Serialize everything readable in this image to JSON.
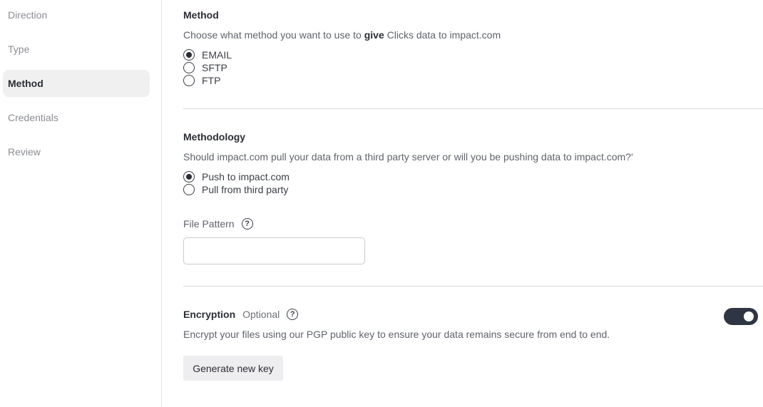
{
  "sidebar": {
    "items": [
      {
        "label": "Direction"
      },
      {
        "label": "Type"
      },
      {
        "label": "Method"
      },
      {
        "label": "Credentials"
      },
      {
        "label": "Review"
      }
    ],
    "active": "Method"
  },
  "method": {
    "title": "Method",
    "desc_before": "Choose what method you want to use to ",
    "desc_bold": "give",
    "desc_after": " Clicks data to impact.com",
    "options": [
      {
        "label": "EMAIL",
        "selected": true
      },
      {
        "label": "SFTP",
        "selected": false
      },
      {
        "label": "FTP",
        "selected": false
      }
    ]
  },
  "methodology": {
    "title": "Methodology",
    "desc": "Should impact.com pull your data from a third party server or will you be pushing data to impact.com?'",
    "options": [
      {
        "label": "Push to impact.com",
        "selected": true
      },
      {
        "label": "Pull from third party",
        "selected": false
      }
    ]
  },
  "file_pattern": {
    "label": "File Pattern",
    "help": "?",
    "value": ""
  },
  "encryption": {
    "title": "Encryption",
    "optional": "Optional",
    "help": "?",
    "desc": "Encrypt your files using our PGP public key to ensure your data remains secure from end to end.",
    "enabled": true,
    "button_label": "Generate new key"
  },
  "icons": {
    "help": "help-circle-icon",
    "toggle": "toggle-switch"
  },
  "colors": {
    "toggle_on": "#2f3542",
    "active_nav_bg": "#f0f0f1"
  }
}
